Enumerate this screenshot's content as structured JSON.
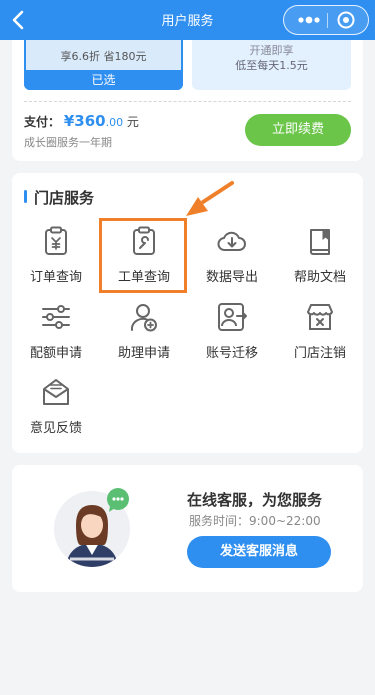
{
  "nav": {
    "title": "用户服务"
  },
  "plans": {
    "selected": {
      "desc": "享6.6折 省180元",
      "badge": "已选"
    },
    "other": {
      "line1": "开通即享",
      "line2": "低至每天1.5元"
    }
  },
  "payment": {
    "label": "支付：",
    "currency": "¥",
    "amount": "360",
    "cents": ".00",
    "unit": "元",
    "sub": "成长圈服务一年期",
    "renew_label": "立即续费"
  },
  "store": {
    "title": "门店服务",
    "items": [
      {
        "label": "订单查询",
        "icon": "order-clipboard-icon"
      },
      {
        "label": "工单查询",
        "icon": "wrench-clipboard-icon"
      },
      {
        "label": "数据导出",
        "icon": "cloud-download-icon"
      },
      {
        "label": "帮助文档",
        "icon": "book-icon"
      },
      {
        "label": "配额申请",
        "icon": "sliders-icon"
      },
      {
        "label": "助理申请",
        "icon": "add-user-icon"
      },
      {
        "label": "账号迁移",
        "icon": "account-transfer-icon"
      },
      {
        "label": "门店注销",
        "icon": "store-close-icon"
      },
      {
        "label": "意见反馈",
        "icon": "feedback-mail-icon"
      }
    ]
  },
  "support": {
    "title": "在线客服，为您服务",
    "hours": "服务时间：9:00~22:00",
    "button": "发送客服消息"
  },
  "colors": {
    "primary": "#2f8ff0",
    "renew": "#6ac548",
    "highlight": "#f07f2a"
  }
}
